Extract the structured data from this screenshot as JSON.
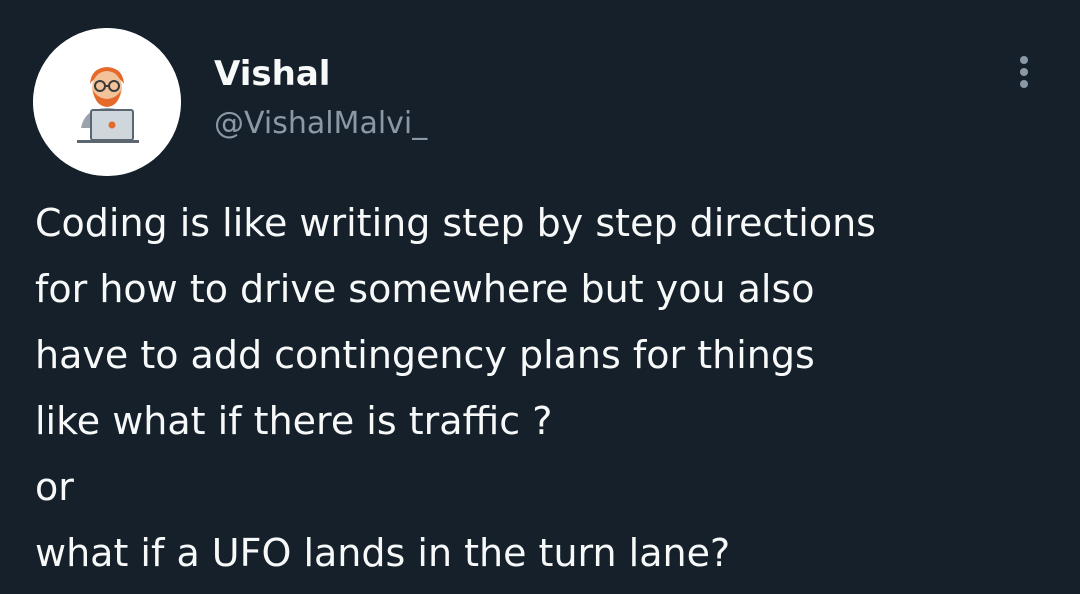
{
  "author": {
    "display_name": "Vishal",
    "handle": "@VishalMalvi_",
    "avatar_icon": "developer-at-laptop-avatar"
  },
  "tweet": {
    "lines": [
      "Coding is like writing step by step directions",
      "for how to drive somewhere but you also",
      "have to add contingency plans for things",
      "like what if there is traffic ?",
      "or",
      "what if a UFO lands in the turn lane?"
    ]
  },
  "menu": {
    "icon": "vertical-ellipsis-icon"
  },
  "colors": {
    "background": "#15202b",
    "text_primary": "#f7f9f9",
    "text_secondary": "#8b98a5"
  }
}
